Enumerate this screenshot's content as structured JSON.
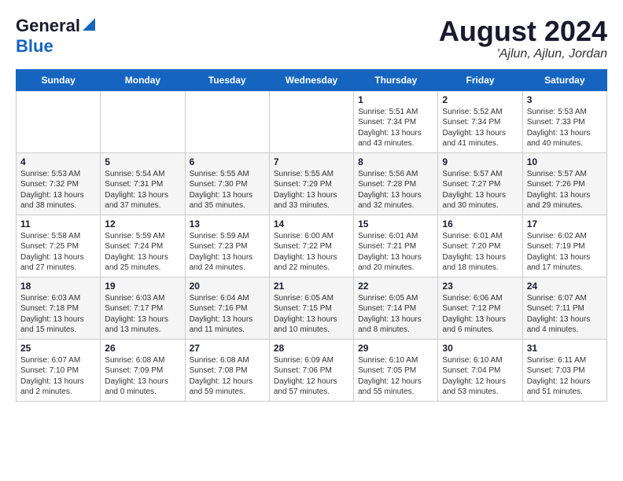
{
  "header": {
    "logo_general": "General",
    "logo_blue": "Blue",
    "title": "August 2024",
    "location": "'Ajlun, Ajlun, Jordan"
  },
  "days_of_week": [
    "Sunday",
    "Monday",
    "Tuesday",
    "Wednesday",
    "Thursday",
    "Friday",
    "Saturday"
  ],
  "weeks": [
    [
      {
        "day": "",
        "sunrise": "",
        "sunset": "",
        "daylight": ""
      },
      {
        "day": "",
        "sunrise": "",
        "sunset": "",
        "daylight": ""
      },
      {
        "day": "",
        "sunrise": "",
        "sunset": "",
        "daylight": ""
      },
      {
        "day": "",
        "sunrise": "",
        "sunset": "",
        "daylight": ""
      },
      {
        "day": "1",
        "sunrise": "Sunrise: 5:51 AM",
        "sunset": "Sunset: 7:34 PM",
        "daylight": "Daylight: 13 hours and 43 minutes."
      },
      {
        "day": "2",
        "sunrise": "Sunrise: 5:52 AM",
        "sunset": "Sunset: 7:34 PM",
        "daylight": "Daylight: 13 hours and 41 minutes."
      },
      {
        "day": "3",
        "sunrise": "Sunrise: 5:53 AM",
        "sunset": "Sunset: 7:33 PM",
        "daylight": "Daylight: 13 hours and 40 minutes."
      }
    ],
    [
      {
        "day": "4",
        "sunrise": "Sunrise: 5:53 AM",
        "sunset": "Sunset: 7:32 PM",
        "daylight": "Daylight: 13 hours and 38 minutes."
      },
      {
        "day": "5",
        "sunrise": "Sunrise: 5:54 AM",
        "sunset": "Sunset: 7:31 PM",
        "daylight": "Daylight: 13 hours and 37 minutes."
      },
      {
        "day": "6",
        "sunrise": "Sunrise: 5:55 AM",
        "sunset": "Sunset: 7:30 PM",
        "daylight": "Daylight: 13 hours and 35 minutes."
      },
      {
        "day": "7",
        "sunrise": "Sunrise: 5:55 AM",
        "sunset": "Sunset: 7:29 PM",
        "daylight": "Daylight: 13 hours and 33 minutes."
      },
      {
        "day": "8",
        "sunrise": "Sunrise: 5:56 AM",
        "sunset": "Sunset: 7:28 PM",
        "daylight": "Daylight: 13 hours and 32 minutes."
      },
      {
        "day": "9",
        "sunrise": "Sunrise: 5:57 AM",
        "sunset": "Sunset: 7:27 PM",
        "daylight": "Daylight: 13 hours and 30 minutes."
      },
      {
        "day": "10",
        "sunrise": "Sunrise: 5:57 AM",
        "sunset": "Sunset: 7:26 PM",
        "daylight": "Daylight: 13 hours and 29 minutes."
      }
    ],
    [
      {
        "day": "11",
        "sunrise": "Sunrise: 5:58 AM",
        "sunset": "Sunset: 7:25 PM",
        "daylight": "Daylight: 13 hours and 27 minutes."
      },
      {
        "day": "12",
        "sunrise": "Sunrise: 5:59 AM",
        "sunset": "Sunset: 7:24 PM",
        "daylight": "Daylight: 13 hours and 25 minutes."
      },
      {
        "day": "13",
        "sunrise": "Sunrise: 5:59 AM",
        "sunset": "Sunset: 7:23 PM",
        "daylight": "Daylight: 13 hours and 24 minutes."
      },
      {
        "day": "14",
        "sunrise": "Sunrise: 6:00 AM",
        "sunset": "Sunset: 7:22 PM",
        "daylight": "Daylight: 13 hours and 22 minutes."
      },
      {
        "day": "15",
        "sunrise": "Sunrise: 6:01 AM",
        "sunset": "Sunset: 7:21 PM",
        "daylight": "Daylight: 13 hours and 20 minutes."
      },
      {
        "day": "16",
        "sunrise": "Sunrise: 6:01 AM",
        "sunset": "Sunset: 7:20 PM",
        "daylight": "Daylight: 13 hours and 18 minutes."
      },
      {
        "day": "17",
        "sunrise": "Sunrise: 6:02 AM",
        "sunset": "Sunset: 7:19 PM",
        "daylight": "Daylight: 13 hours and 17 minutes."
      }
    ],
    [
      {
        "day": "18",
        "sunrise": "Sunrise: 6:03 AM",
        "sunset": "Sunset: 7:18 PM",
        "daylight": "Daylight: 13 hours and 15 minutes."
      },
      {
        "day": "19",
        "sunrise": "Sunrise: 6:03 AM",
        "sunset": "Sunset: 7:17 PM",
        "daylight": "Daylight: 13 hours and 13 minutes."
      },
      {
        "day": "20",
        "sunrise": "Sunrise: 6:04 AM",
        "sunset": "Sunset: 7:16 PM",
        "daylight": "Daylight: 13 hours and 11 minutes."
      },
      {
        "day": "21",
        "sunrise": "Sunrise: 6:05 AM",
        "sunset": "Sunset: 7:15 PM",
        "daylight": "Daylight: 13 hours and 10 minutes."
      },
      {
        "day": "22",
        "sunrise": "Sunrise: 6:05 AM",
        "sunset": "Sunset: 7:14 PM",
        "daylight": "Daylight: 13 hours and 8 minutes."
      },
      {
        "day": "23",
        "sunrise": "Sunrise: 6:06 AM",
        "sunset": "Sunset: 7:12 PM",
        "daylight": "Daylight: 13 hours and 6 minutes."
      },
      {
        "day": "24",
        "sunrise": "Sunrise: 6:07 AM",
        "sunset": "Sunset: 7:11 PM",
        "daylight": "Daylight: 13 hours and 4 minutes."
      }
    ],
    [
      {
        "day": "25",
        "sunrise": "Sunrise: 6:07 AM",
        "sunset": "Sunset: 7:10 PM",
        "daylight": "Daylight: 13 hours and 2 minutes."
      },
      {
        "day": "26",
        "sunrise": "Sunrise: 6:08 AM",
        "sunset": "Sunset: 7:09 PM",
        "daylight": "Daylight: 13 hours and 0 minutes."
      },
      {
        "day": "27",
        "sunrise": "Sunrise: 6:08 AM",
        "sunset": "Sunset: 7:08 PM",
        "daylight": "Daylight: 12 hours and 59 minutes."
      },
      {
        "day": "28",
        "sunrise": "Sunrise: 6:09 AM",
        "sunset": "Sunset: 7:06 PM",
        "daylight": "Daylight: 12 hours and 57 minutes."
      },
      {
        "day": "29",
        "sunrise": "Sunrise: 6:10 AM",
        "sunset": "Sunset: 7:05 PM",
        "daylight": "Daylight: 12 hours and 55 minutes."
      },
      {
        "day": "30",
        "sunrise": "Sunrise: 6:10 AM",
        "sunset": "Sunset: 7:04 PM",
        "daylight": "Daylight: 12 hours and 53 minutes."
      },
      {
        "day": "31",
        "sunrise": "Sunrise: 6:11 AM",
        "sunset": "Sunset: 7:03 PM",
        "daylight": "Daylight: 12 hours and 51 minutes."
      }
    ]
  ]
}
